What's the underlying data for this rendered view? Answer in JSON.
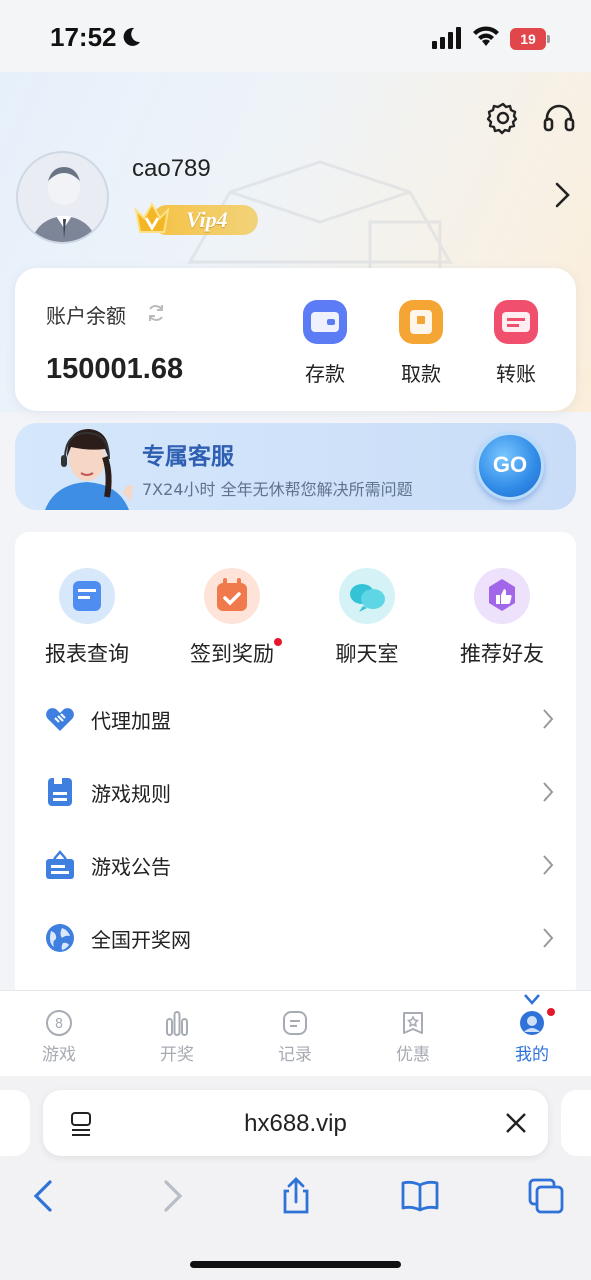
{
  "status_bar": {
    "time": "17:52",
    "battery": "19"
  },
  "profile": {
    "username": "cao789",
    "vip_level": "Vip4"
  },
  "balance": {
    "label": "账户余额",
    "value": "150001.68",
    "actions": [
      {
        "label": "存款",
        "icon": "deposit-wallet-icon",
        "color": "#5b7cf5"
      },
      {
        "label": "取款",
        "icon": "withdraw-icon",
        "color": "#f5a533"
      },
      {
        "label": "转账",
        "icon": "transfer-icon",
        "color": "#f0506d"
      }
    ]
  },
  "banner": {
    "title": "专属客服",
    "subtitle": "7X24小时 全年无休帮您解决所需问题",
    "go_label": "GO"
  },
  "quick_actions": [
    {
      "label": "报表查询",
      "icon": "report-icon",
      "color": "#4f8df0",
      "bg": "#d8e8fb",
      "badge": false
    },
    {
      "label": "签到奖励",
      "icon": "calendar-check-icon",
      "color": "#f07a4c",
      "bg": "#fde3d8",
      "badge": true
    },
    {
      "label": "聊天室",
      "icon": "chat-bubbles-icon",
      "color": "#34c2d6",
      "bg": "#d5f3f7",
      "badge": false
    },
    {
      "label": "推荐好友",
      "icon": "thumbs-up-icon",
      "color": "#a266e8",
      "bg": "#eee1fb",
      "badge": false
    }
  ],
  "menu_rows": [
    {
      "label": "代理加盟",
      "icon": "handshake-icon"
    },
    {
      "label": "游戏规则",
      "icon": "rules-book-icon"
    },
    {
      "label": "游戏公告",
      "icon": "notice-board-icon"
    },
    {
      "label": "全国开奖网",
      "icon": "globe-icon"
    }
  ],
  "tabs": [
    {
      "label": "游戏",
      "icon": "game-ball-icon",
      "active": false
    },
    {
      "label": "开奖",
      "icon": "bar-chart-icon",
      "active": false
    },
    {
      "label": "记录",
      "icon": "record-icon",
      "active": false
    },
    {
      "label": "优惠",
      "icon": "promo-icon",
      "active": false
    },
    {
      "label": "我的",
      "icon": "profile-icon",
      "active": true
    }
  ],
  "browser": {
    "url": "hx688.vip"
  }
}
